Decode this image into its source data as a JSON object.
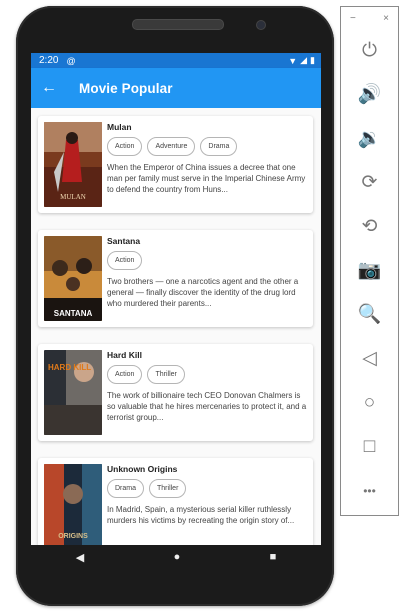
{
  "status_bar": {
    "time": "2:20",
    "status_icon": "@"
  },
  "app_bar": {
    "title": "Movie Popular",
    "back_icon": "←"
  },
  "movies": [
    {
      "title": "Mulan",
      "genres": [
        "Action",
        "Adventure",
        "Drama"
      ],
      "overview": "When the Emperor of China issues a decree that one man per family must serve in the Imperial Chinese Army to defend the country from Huns...",
      "poster_text": "MULAN"
    },
    {
      "title": "Santana",
      "genres": [
        "Action"
      ],
      "overview": "Two brothers — one a narcotics agent and the other a general — finally discover the identity of the drug lord who murdered their parents...",
      "poster_text": "SANTANA"
    },
    {
      "title": "Hard Kill",
      "genres": [
        "Action",
        "Thriller"
      ],
      "overview": "The work of billionaire tech CEO Donovan Chalmers is so valuable that he hires mercenaries to protect it, and a terrorist group...",
      "poster_text": "HARD KILL"
    },
    {
      "title": "Unknown Origins",
      "genres": [
        "Drama",
        "Thriller"
      ],
      "overview": "In Madrid, Spain, a mysterious serial killer ruthlessly murders his victims by recreating the origin story of...",
      "poster_text": "ORIGINS"
    }
  ],
  "emulator_toolbar": {
    "minimize": "−",
    "close": "×",
    "tools": [
      "⏻",
      "🔊",
      "🔉",
      "⟳",
      "⟲",
      "📷",
      "🔍",
      "◁",
      "○",
      "□",
      "•••"
    ],
    "tool_names": [
      "power",
      "volume-up",
      "volume-down",
      "rotate-left",
      "rotate-right",
      "screenshot",
      "zoom",
      "back",
      "home",
      "overview",
      "more"
    ]
  },
  "colors": {
    "primary": "#2196f3",
    "status_bar": "#1976d2",
    "phone_body": "#1b1b1b"
  }
}
